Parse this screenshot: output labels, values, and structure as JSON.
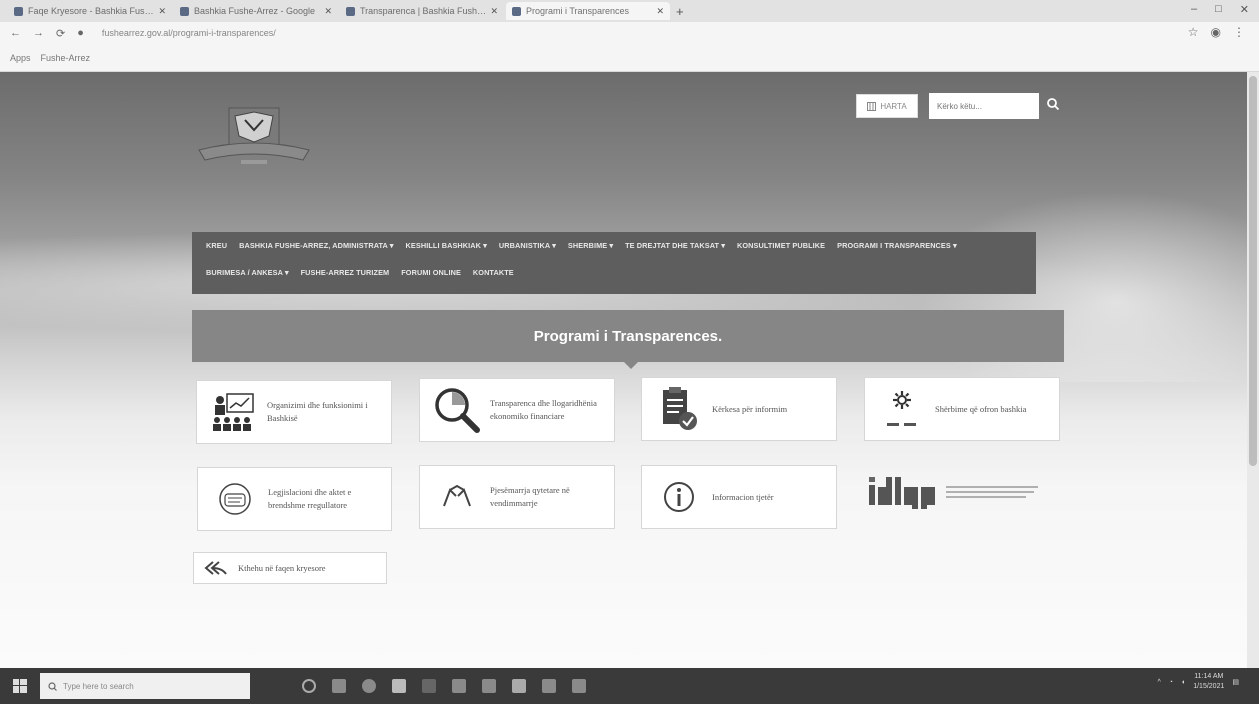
{
  "browser": {
    "tabs": [
      {
        "title": "Faqe Kryesore - Bashkia Fushe-Kruje",
        "active": false
      },
      {
        "title": "Bashkia Fushe-Arrez - Google",
        "active": false
      },
      {
        "title": "Transparenca | Bashkia Fushe-Arrez",
        "active": false
      },
      {
        "title": "Programi i Transparences",
        "active": true
      }
    ],
    "new_tab": "+",
    "window_controls": [
      "–",
      "□",
      "✕"
    ],
    "url": "fushearrez.gov.al/programi-i-transparences/",
    "bookmarks": [
      "Apps",
      "Fushe-Arrez"
    ]
  },
  "header": {
    "map_label": "HARTA",
    "search_placeholder": "Kërko këtu..."
  },
  "menu": {
    "items": [
      "KREU",
      "BASHKIA FUSHE-ARREZ, ADMINISTRATA ▾",
      "KESHILLI BASHKIAK ▾",
      "URBANISTIKA ▾",
      "SHERBIME ▾",
      "TE DREJTAT DHE TAKSAT ▾",
      "KONSULTIMET PUBLIKE",
      "PROGRAMI I TRANSPARENCES ▾",
      "BURIMESA / ANKESA ▾",
      "FUSHE-ARREZ TURIZEM",
      "FORUMI ONLINE",
      "KONTAKTE"
    ]
  },
  "page": {
    "title": "Programi i Transparences."
  },
  "cards": [
    {
      "label": "Organizimi dhe funksionimi i Bashkisë",
      "icon": "organization-icon"
    },
    {
      "label": "Transparenca dhe llogaridhënia ekonomiko financiare",
      "icon": "magnifier-icon"
    },
    {
      "label": "Kërkesa për informim",
      "icon": "clipboard-check-icon"
    },
    {
      "label": "Shërbime që ofron bashkia",
      "icon": "gear-icon"
    },
    {
      "label": "Legjislacioni dhe aktet e brendshme rregullatore",
      "icon": "law-icon"
    },
    {
      "label": "Pjesëmarrja qytetare në vendimmarrje",
      "icon": "handshake-icon"
    },
    {
      "label": "Informacion tjetër",
      "icon": "info-icon"
    }
  ],
  "back_button": "Kthehu në faqen kryesore",
  "taskbar": {
    "search_placeholder": "Type here to search",
    "time": "11:14 AM",
    "date": "1/15/2021"
  },
  "colors": {
    "menu_bg": "#5e5e5e",
    "banner_bg": "#868686",
    "taskbar_bg": "#3a3a3a"
  }
}
